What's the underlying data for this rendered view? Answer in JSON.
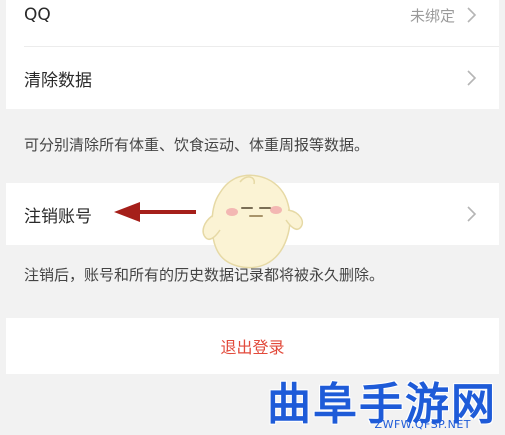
{
  "settings": {
    "qq": {
      "label": "QQ",
      "value": "未绑定"
    },
    "clear_data": {
      "label": "清除数据"
    },
    "clear_data_note": "可分别清除所有体重、饮食运动、体重周报等数据。",
    "delete_account": {
      "label": "注销账号"
    },
    "delete_account_note": "注销后，账号和所有的历史数据记录都将被永久删除。",
    "logout_label": "退出登录"
  },
  "watermark": {
    "title": "曲阜手游网",
    "url": "ZWFW.QFSP.NET"
  },
  "icons": {
    "chevron": "chevron-right-icon",
    "arrow": "red-arrow-left-icon",
    "mascot": "mascot-sticker"
  },
  "colors": {
    "logout": "#e24a3b",
    "arrow": "#a51f1a",
    "watermark": "#1e5bd8"
  }
}
